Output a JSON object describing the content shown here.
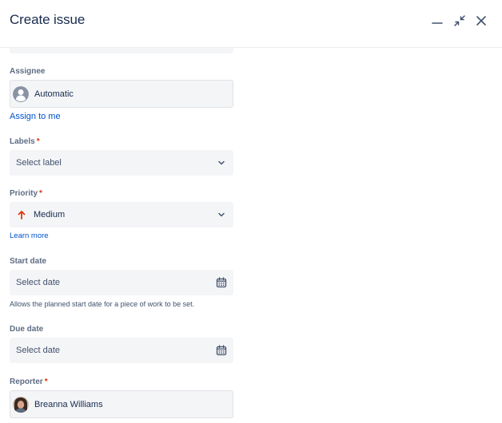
{
  "dialog": {
    "title": "Create issue"
  },
  "assignee": {
    "label": "Assignee",
    "value": "Automatic",
    "assign_to_me": "Assign to me"
  },
  "labels": {
    "label": "Labels",
    "required_mark": "*",
    "placeholder": "Select label"
  },
  "priority": {
    "label": "Priority",
    "required_mark": "*",
    "value": "Medium",
    "icon_color": "#de350b",
    "learn_more": "Learn more"
  },
  "start_date": {
    "label": "Start date",
    "placeholder": "Select date",
    "helper": "Allows the planned start date for a piece of work to be set."
  },
  "due_date": {
    "label": "Due date",
    "placeholder": "Select date"
  },
  "reporter": {
    "label": "Reporter",
    "required_mark": "*",
    "value": "Breanna Williams"
  },
  "colors": {
    "text": "#172b4d",
    "subtle": "#5e6c84",
    "link": "#0052cc",
    "required": "#de350b",
    "field_bg": "#f4f5f7"
  }
}
